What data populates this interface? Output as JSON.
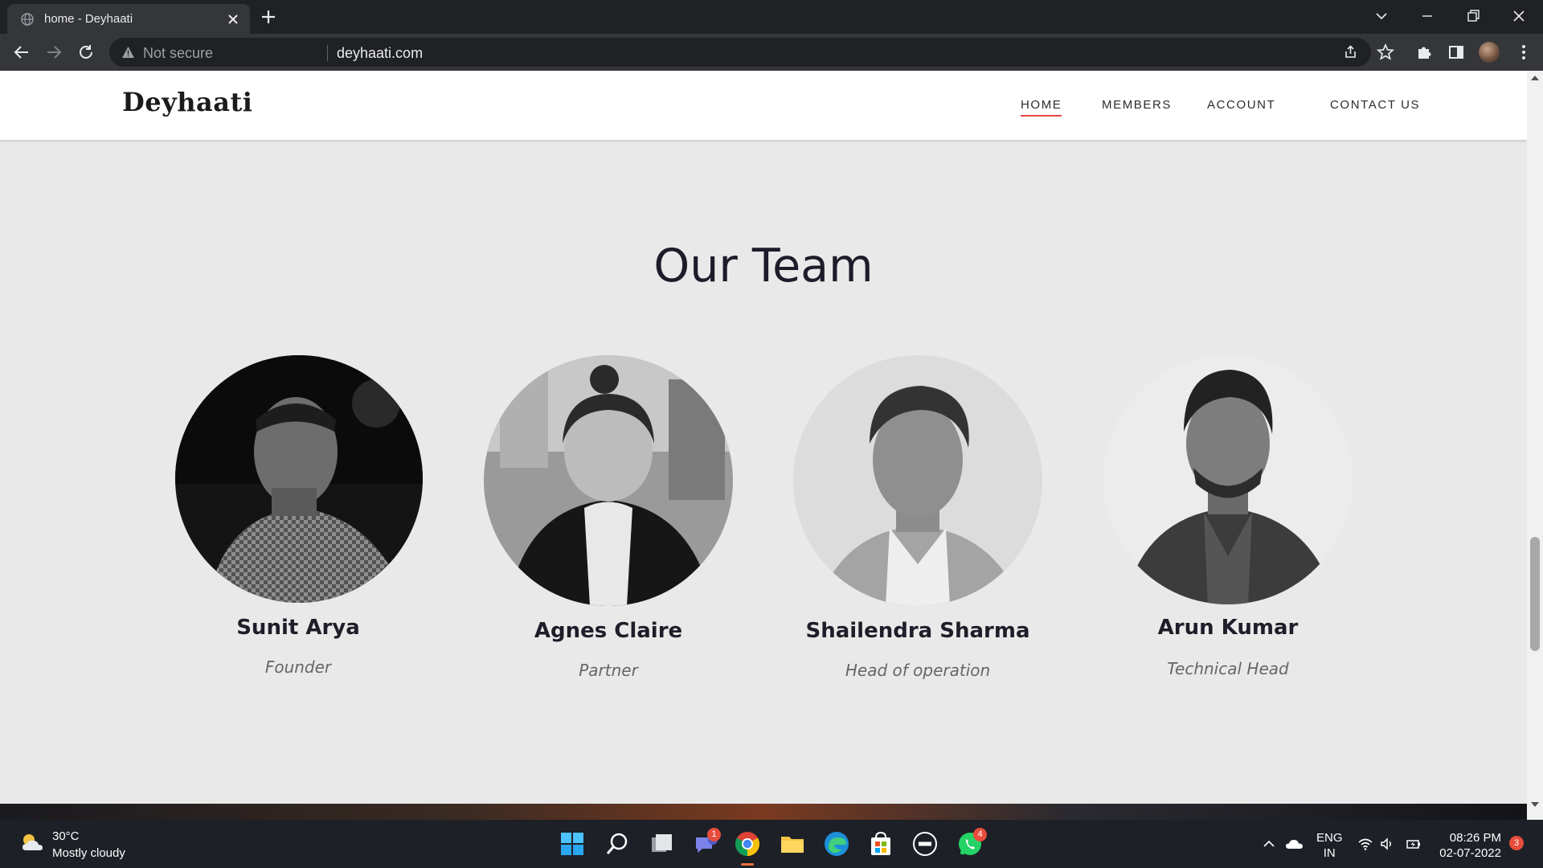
{
  "browser": {
    "tab": {
      "title": "home - Deyhaati"
    },
    "omnibox": {
      "security_label": "Not secure",
      "url": "deyhaati.com"
    }
  },
  "site": {
    "logo": "Deyhaati",
    "nav": [
      {
        "label": "HOME",
        "active": true
      },
      {
        "label": "MEMBERS",
        "active": false
      },
      {
        "label": "ACCOUNT",
        "active": false
      },
      {
        "label": "CONTACT US",
        "active": false
      }
    ],
    "accent_color": "#e8473f"
  },
  "team": {
    "title": "Our Team",
    "members": [
      {
        "name": "Sunit Arya",
        "role": "Founder"
      },
      {
        "name": "Agnes Claire",
        "role": "Partner"
      },
      {
        "name": "Shailendra Sharma",
        "role": "Head of operation"
      },
      {
        "name": "Arun Kumar",
        "role": "Technical Head"
      }
    ]
  },
  "taskbar": {
    "weather": {
      "temp": "30°C",
      "desc": "Mostly cloudy"
    },
    "badges": {
      "teams": "1",
      "whatsapp": "4"
    },
    "language": {
      "line1": "ENG",
      "line2": "IN"
    },
    "clock": {
      "time": "08:26 PM",
      "date": "02-07-2022"
    },
    "notifications": "3"
  }
}
